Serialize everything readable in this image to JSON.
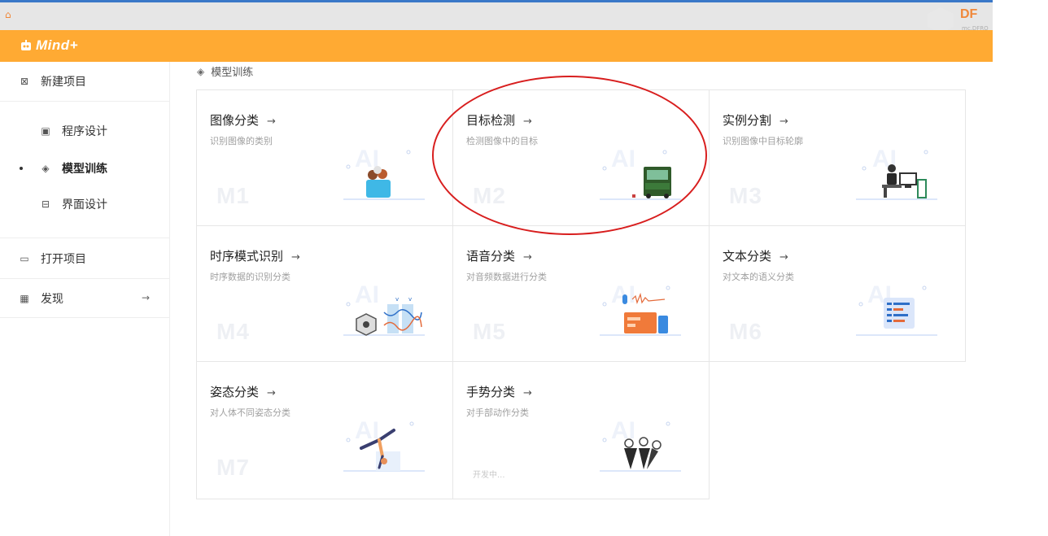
{
  "window": {
    "brand": "Mind+",
    "vendor_logo": "DF",
    "vendor_sub": "mc.DFRO"
  },
  "sidebar": {
    "new_project": "新建项目",
    "sub_items": [
      {
        "label": "程序设计",
        "icon": "code-window-icon",
        "active": false
      },
      {
        "label": "模型训练",
        "icon": "cube-icon",
        "active": true
      },
      {
        "label": "界面设计",
        "icon": "layout-icon",
        "active": false
      }
    ],
    "open_project": "打开项目",
    "discover": "发现",
    "discover_arrow": "→"
  },
  "breadcrumb": {
    "label": "模型训练"
  },
  "cards": [
    {
      "title": "图像分类",
      "arrow": "→",
      "desc": "识别图像的类别",
      "code": "M1",
      "status": ""
    },
    {
      "title": "目标检测",
      "arrow": "→",
      "desc": "检测图像中的目标",
      "code": "M2",
      "status": ""
    },
    {
      "title": "实例分割",
      "arrow": "→",
      "desc": "识别图像中目标轮廓",
      "code": "M3",
      "status": ""
    },
    {
      "title": "时序模式识别",
      "arrow": "→",
      "desc": "时序数据的识别分类",
      "code": "M4",
      "status": ""
    },
    {
      "title": "语音分类",
      "arrow": "→",
      "desc": "对音频数据进行分类",
      "code": "M5",
      "status": ""
    },
    {
      "title": "文本分类",
      "arrow": "→",
      "desc": "对文本的语义分类",
      "code": "M6",
      "status": ""
    },
    {
      "title": "姿态分类",
      "arrow": "→",
      "desc": "对人体不同姿态分类",
      "code": "M7",
      "status": ""
    },
    {
      "title": "手势分类",
      "arrow": "→",
      "desc": "对手部动作分类",
      "code": "",
      "status": "开发中..."
    }
  ],
  "colors": {
    "accent": "#ffaa33",
    "annotation": "#d81e1e",
    "card_border": "#e6e6e6"
  }
}
